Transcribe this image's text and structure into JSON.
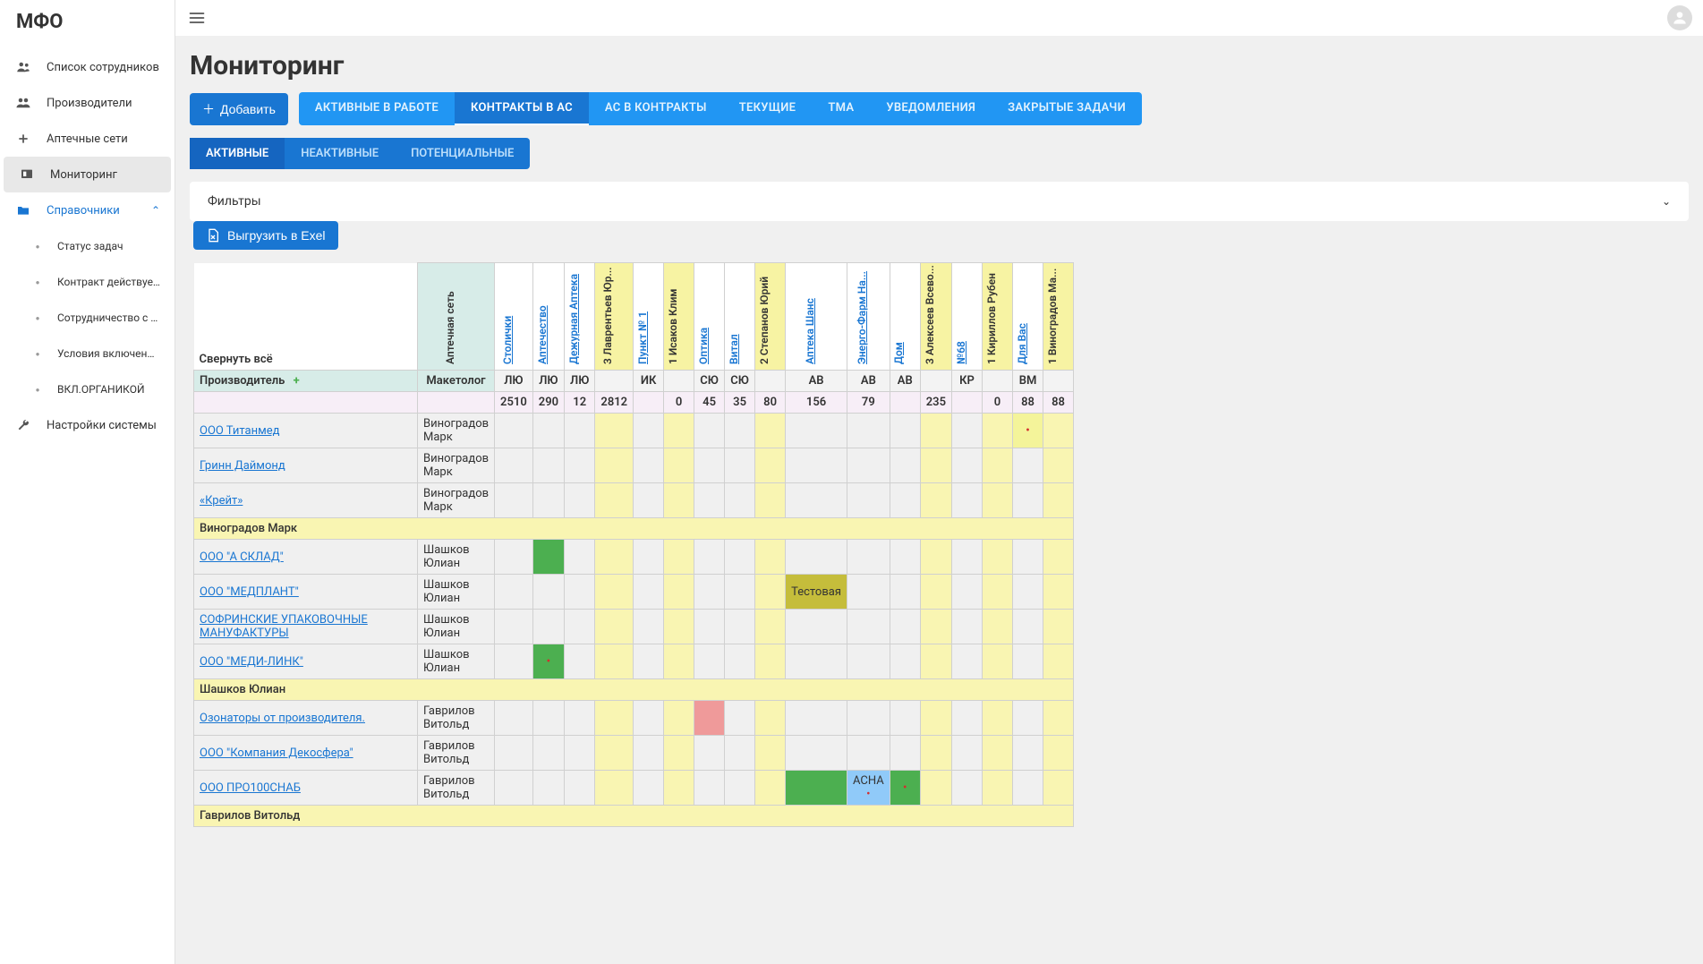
{
  "app": {
    "logo": "МФО"
  },
  "sidebar": {
    "items": [
      {
        "label": "Список сотрудников",
        "icon": "users"
      },
      {
        "label": "Производители",
        "icon": "group"
      },
      {
        "label": "Аптечные сети",
        "icon": "plus"
      },
      {
        "label": "Мониторинг",
        "icon": "monitor",
        "active": true
      },
      {
        "label": "Справочники",
        "icon": "folder",
        "open": true
      },
      {
        "label": "Статус задач",
        "sub": true
      },
      {
        "label": "Контракт действует с",
        "sub": true
      },
      {
        "label": "Сотрудничество с др.асс...",
        "sub": true
      },
      {
        "label": "Условия включения АС в ...",
        "sub": true
      },
      {
        "label": "ВКЛ.ОРГАНИКОЙ",
        "sub": true
      },
      {
        "label": "Настройки системы",
        "icon": "wrench"
      }
    ]
  },
  "page": {
    "title": "Мониторинг",
    "add_label": "Добавить",
    "tabs_main": [
      "АКТИВНЫЕ В РАБОТЕ",
      "КОНТРАКТЫ В АС",
      "АС В КОНТРАКТЫ",
      "ТЕКУЩИЕ",
      "ТМА",
      "УВЕДОМЛЕНИЯ",
      "ЗАКРЫТЫЕ ЗАДАЧИ"
    ],
    "tabs_main_active": 1,
    "tabs_sub": [
      "АКТИВНЫЕ",
      "НЕАКТИВНЫЕ",
      "ПОТЕНЦИАЛЬНЫЕ"
    ],
    "tabs_sub_active": 0,
    "filters_label": "Фильтры",
    "export_label": "Выгрузить в Exel"
  },
  "grid": {
    "collapse_label": "Свернуть всё",
    "network_label": "Аптечная сеть",
    "producer_label": "Производитель",
    "marketer_label": "Макетолог",
    "columns": [
      {
        "name": "Столички",
        "link": true,
        "code": "ЛЮ",
        "total": "2510"
      },
      {
        "name": "Аптечество",
        "link": true,
        "code": "ЛЮ",
        "total": "290"
      },
      {
        "name": "Дежурная Аптека",
        "link": true,
        "code": "ЛЮ",
        "total": "12"
      },
      {
        "name": "3 Лаврентьев Юр...",
        "link": false,
        "yellow": true,
        "code": "",
        "total": "2812"
      },
      {
        "name": "Пункт № 1",
        "link": true,
        "code": "ИК",
        "total": ""
      },
      {
        "name": "1 Исаков Клим",
        "link": false,
        "yellow": true,
        "code": "",
        "total": "0"
      },
      {
        "name": "Оптика",
        "link": true,
        "code": "СЮ",
        "total": "45"
      },
      {
        "name": "Витал",
        "link": true,
        "code": "СЮ",
        "total": "35"
      },
      {
        "name": "2 Степанов Юрий",
        "link": false,
        "yellow": true,
        "code": "",
        "total": "80"
      },
      {
        "name": "Аптека Шанс",
        "link": true,
        "code": "АВ",
        "total": "156"
      },
      {
        "name": "Энерго-Фарм На...",
        "link": true,
        "code": "АВ",
        "total": "79"
      },
      {
        "name": "Дом",
        "link": true,
        "code": "АВ",
        "total": ""
      },
      {
        "name": "3 Алексеев Всево...",
        "link": false,
        "yellow": true,
        "code": "",
        "total": "235"
      },
      {
        "name": "№68",
        "link": true,
        "code": "КР",
        "total": ""
      },
      {
        "name": "1 Кириллов Рубен",
        "link": false,
        "yellow": true,
        "code": "",
        "total": "0"
      },
      {
        "name": "Для Вас",
        "link": true,
        "code": "ВМ",
        "total": "88"
      },
      {
        "name": "1 Виноградов Ма...",
        "link": false,
        "yellow": true,
        "code": "",
        "total": "88"
      }
    ],
    "rows": [
      {
        "producer": "ООО Титанмед",
        "marketer": "Виноградов Марк",
        "cells": {
          "15": {
            "cls": "cell-lime dot-red"
          }
        }
      },
      {
        "producer": "Гринн Даймонд",
        "marketer": "Виноградов Марк",
        "cells": {}
      },
      {
        "producer": "«Крейт»",
        "marketer": "Виноградов Марк",
        "cells": {}
      },
      {
        "group": "Виноградов Марк"
      },
      {
        "producer": "ООО \"А СКЛАД\"",
        "marketer": "Шашков Юлиан",
        "cells": {
          "1": {
            "cls": "cell-green"
          }
        }
      },
      {
        "producer": "ООО \"МЕДПЛАНТ\"",
        "marketer": "Шашков Юлиан",
        "cells": {
          "9": {
            "cls": "cell-olive",
            "text": "Тестовая"
          }
        }
      },
      {
        "producer": "СОФРИНСКИЕ УПАКОВОЧНЫЕ МАНУФАКТУРЫ",
        "marketer": "Шашков Юлиан",
        "cells": {}
      },
      {
        "producer": "ООО \"МЕДИ-ЛИНК\"",
        "marketer": "Шашков Юлиан",
        "cells": {
          "1": {
            "cls": "cell-green dot-red"
          }
        }
      },
      {
        "group": "Шашков Юлиан"
      },
      {
        "producer": "Озонаторы от производителя.",
        "marketer": "Гаврилов Витольд",
        "cells": {
          "6": {
            "cls": "cell-red"
          }
        }
      },
      {
        "producer": "ООО \"Компания Декосфера\"",
        "marketer": "Гаврилов Витольд",
        "cells": {}
      },
      {
        "producer": "ООО ПРО100СНАБ",
        "marketer": "Гаврилов Витольд",
        "cells": {
          "9": {
            "cls": "cell-green"
          },
          "10": {
            "cls": "cell-blue",
            "text": "АСНА",
            "dot": true
          },
          "11": {
            "cls": "cell-green dot-red"
          }
        }
      },
      {
        "group": "Гаврилов Витольд"
      }
    ]
  }
}
